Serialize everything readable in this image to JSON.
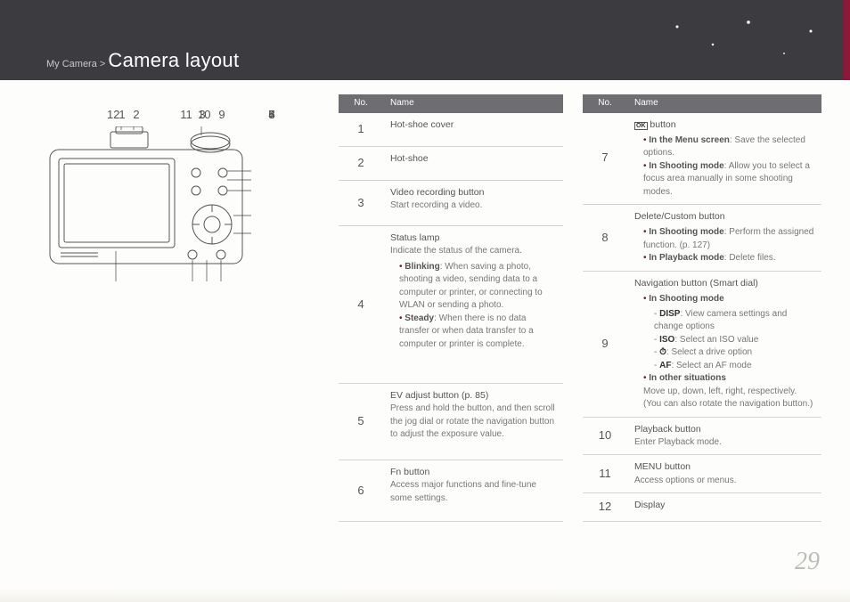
{
  "breadcrumb": {
    "section": "My Camera",
    "sep": ">",
    "title": "Camera layout"
  },
  "page_number": "29",
  "callouts": {
    "c1": "1",
    "c2": "2",
    "c3": "3",
    "c4": "4",
    "c5": "5",
    "c6": "6",
    "c7": "7",
    "c8": "8",
    "c9": "9",
    "c10": "10",
    "c11": "11",
    "c12": "12"
  },
  "table_headers": {
    "no": "No.",
    "name": "Name"
  },
  "table1": [
    {
      "no": "1",
      "name": "Hot-shoe cover"
    },
    {
      "no": "2",
      "name": "Hot-shoe"
    },
    {
      "no": "3",
      "name": "Video recording button",
      "desc": "Start recording a video."
    },
    {
      "no": "4",
      "name": "Status lamp",
      "desc_intro": "Indicate the status of the camera.",
      "bullets": [
        {
          "label": "Blinking",
          "text": ": When saving a photo, shooting a video, sending data to a computer or printer, or connecting to WLAN or sending a photo."
        },
        {
          "label": "Steady",
          "text": ": When there is no data transfer or when data transfer to a computer or printer is complete."
        }
      ]
    },
    {
      "no": "5",
      "name": "EV adjust button (p. 85)",
      "desc": "Press and hold the button, and then scroll the jog dial or rotate the navigation button to adjust the exposure value."
    },
    {
      "no": "6",
      "name": "Fn button",
      "desc": "Access major functions and fine-tune some settings."
    }
  ],
  "table2": [
    {
      "no": "7",
      "icon_name": "ok-icon",
      "name_suffix": " button",
      "bullets": [
        {
          "label": "In the Menu screen",
          "text": ": Save the selected options."
        },
        {
          "label": "In Shooting mode",
          "text": ": Allow you to select a focus area manually in some shooting modes."
        }
      ]
    },
    {
      "no": "8",
      "name": "Delete/Custom button",
      "bullets": [
        {
          "label": "In Shooting mode",
          "text": ": Perform the assigned function. (p. 127)"
        },
        {
          "label": "In Playback mode",
          "text": ": Delete files."
        }
      ]
    },
    {
      "no": "9",
      "name": "Navigation button (Smart dial)",
      "shooting_label": "In Shooting mode",
      "dashes": [
        {
          "icon": "DISP",
          "text": ": View camera settings and change options"
        },
        {
          "icon": "ISO",
          "text": ": Select an ISO value"
        },
        {
          "icon": "⏱",
          "text": ": Select a drive option"
        },
        {
          "icon": "AF",
          "text": ": Select an AF mode"
        }
      ],
      "other_label": "In other situations",
      "other_text": "Move up, down, left, right, respectively. (You can also rotate the navigation button.)"
    },
    {
      "no": "10",
      "name": "Playback button",
      "desc": "Enter Playback mode."
    },
    {
      "no": "11",
      "name": "MENU button",
      "desc": "Access options or menus."
    },
    {
      "no": "12",
      "name": "Display"
    }
  ]
}
